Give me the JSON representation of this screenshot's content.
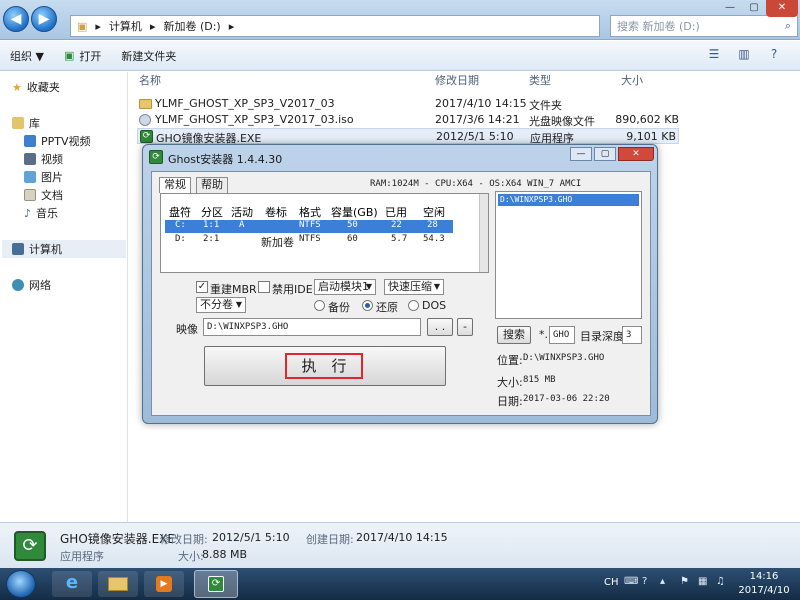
{
  "explorer": {
    "breadcrumb": [
      "计算机",
      "新加卷 (D:)"
    ],
    "search_placeholder": "搜索 新加卷 (D:)",
    "toolbar": {
      "organize": "组织 ▼",
      "open": "打开",
      "new_folder": "新建文件夹"
    },
    "sidebar": {
      "favorites": "收藏夹",
      "libraries": "库",
      "lib_items": [
        "PPTV视频",
        "视频",
        "图片",
        "文档",
        "音乐"
      ],
      "computer": "计算机",
      "network": "网络"
    },
    "columns": {
      "name": "名称",
      "modified": "修改日期",
      "type": "类型",
      "size": "大小"
    },
    "files": [
      {
        "name": "YLMF_GHOST_XP_SP3_V2017_03",
        "modified": "2017/4/10 14:15",
        "type": "文件夹",
        "size": "",
        "icon": "folder-icon"
      },
      {
        "name": "YLMF_GHOST_XP_SP3_V2017_03.iso",
        "modified": "2017/3/6 14:21",
        "type": "光盘映像文件",
        "size": "890,602 KB",
        "icon": "iso-icon"
      },
      {
        "name": "GHO镜像安装器.EXE",
        "modified": "2012/5/1 5:10",
        "type": "应用程序",
        "size": "9,101 KB",
        "icon": "gho-icon"
      }
    ],
    "details": {
      "filename": "GHO镜像安装器.EXE",
      "modified_label": "修改日期:",
      "modified": "2012/5/1 5:10",
      "created_label": "创建日期:",
      "created": "2017/4/10 14:15",
      "type": "应用程序",
      "size_label": "大小:",
      "size": "8.88 MB"
    }
  },
  "ghost": {
    "title": "Ghost安装器 1.4.4.30",
    "tabs": [
      "常规",
      "帮助"
    ],
    "sysinfo": "RAM:1024M - CPU:X64 - OS:X64 WIN_7 AMCI",
    "headers": [
      "盘符",
      "分区",
      "活动",
      "卷标",
      "格式",
      "容量(GB)",
      "已用",
      "空闲"
    ],
    "partitions": [
      [
        "C:",
        "1:1",
        "A",
        "",
        "NTFS",
        "50",
        "22",
        "28"
      ],
      [
        "D:",
        "2:1",
        "",
        "新加卷",
        "NTFS",
        "60",
        "5.7",
        "54.3"
      ]
    ],
    "rebuild_mbr": "重建MBR",
    "disable_ide": "禁用IDE",
    "boot_module": "启动模块1",
    "compress": "快速压缩",
    "no_partition": "不分卷",
    "backup": "备份",
    "restore": "还原",
    "dos": "DOS",
    "image_label": "映像",
    "image_path": "D:\\WINXPSP3.GHO",
    "browse": ". .",
    "minus": "-",
    "execute": "执　行",
    "search_btn": "搜索",
    "ext_prefix": "*.",
    "ext": "GHO",
    "depth_label": "目录深度",
    "depth": "3",
    "result_list": [
      "D:\\WINXPSP3.GHO"
    ],
    "location_label": "位置:",
    "location": "D:\\WINXPSP3.GHO",
    "size_label": "大小:",
    "size": "815 MB",
    "date_label": "日期:",
    "date": "2017-03-06  22:20"
  },
  "taskbar": {
    "lang": "CH",
    "time": "14:16",
    "date": "2017/4/10"
  }
}
